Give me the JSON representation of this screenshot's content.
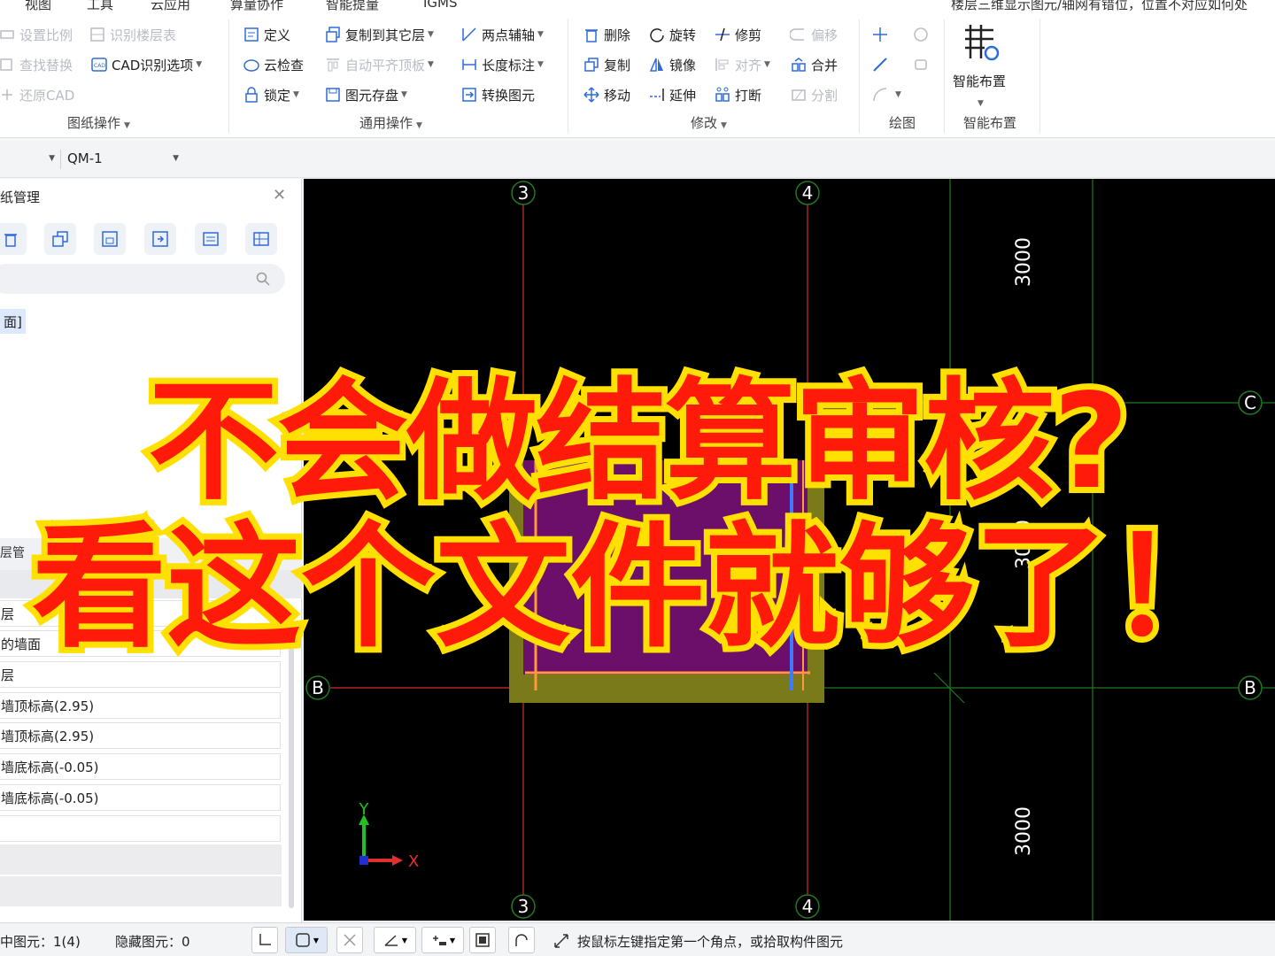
{
  "menu": [
    "视图",
    "工具",
    "云应用",
    "算量协作",
    "智能提量",
    "IGMS"
  ],
  "top_notice": "楼层三维显示图元/轴网有错位，位置不对应如何处",
  "ribbon": {
    "groups": [
      {
        "label": "图纸操作",
        "items": [
          {
            "label": "设置比例",
            "icon": "scale-icon",
            "disabled": true
          },
          {
            "label": "识别楼层表",
            "icon": "floor-table-icon",
            "disabled": true
          },
          {
            "label": "查找替换",
            "icon": "find-replace-icon",
            "disabled": true
          },
          {
            "label": "CAD识别选项",
            "icon": "cad-options-icon",
            "disabled": false
          },
          {
            "label": "还原CAD",
            "icon": "restore-cad-icon",
            "disabled": true
          }
        ]
      },
      {
        "label": "通用操作",
        "items": [
          {
            "label": "定义",
            "icon": "define-icon",
            "disabled": false
          },
          {
            "label": "复制到其它层",
            "icon": "copy-layer-icon",
            "disabled": false
          },
          {
            "label": "两点辅轴",
            "icon": "two-point-axis-icon",
            "disabled": false
          },
          {
            "label": "云检查",
            "icon": "cloud-check-icon",
            "disabled": false
          },
          {
            "label": "自动平齐顶板",
            "icon": "align-top-icon",
            "disabled": true
          },
          {
            "label": "长度标注",
            "icon": "length-dim-icon",
            "disabled": false
          },
          {
            "label": "锁定",
            "icon": "lock-icon",
            "disabled": false
          },
          {
            "label": "图元存盘",
            "icon": "save-element-icon",
            "disabled": false
          },
          {
            "label": "转换图元",
            "icon": "convert-element-icon",
            "disabled": false
          }
        ]
      },
      {
        "label": "修改",
        "items": [
          {
            "label": "删除",
            "icon": "delete-icon",
            "disabled": false
          },
          {
            "label": "旋转",
            "icon": "rotate-icon",
            "disabled": false
          },
          {
            "label": "修剪",
            "icon": "trim-icon",
            "disabled": false
          },
          {
            "label": "偏移",
            "icon": "offset-icon",
            "disabled": true
          },
          {
            "label": "复制",
            "icon": "copy-icon",
            "disabled": false
          },
          {
            "label": "镜像",
            "icon": "mirror-icon",
            "disabled": false
          },
          {
            "label": "对齐",
            "icon": "align-icon",
            "disabled": true
          },
          {
            "label": "合并",
            "icon": "merge-icon",
            "disabled": false
          },
          {
            "label": "移动",
            "icon": "move-icon",
            "disabled": false
          },
          {
            "label": "延伸",
            "icon": "extend-icon",
            "disabled": false
          },
          {
            "label": "打断",
            "icon": "break-icon",
            "disabled": false
          },
          {
            "label": "分割",
            "icon": "split-icon",
            "disabled": true
          }
        ]
      },
      {
        "label": "绘图",
        "items": []
      },
      {
        "label": "智能布置",
        "items": [
          {
            "label": "智能布置",
            "icon": "smart-layout-icon",
            "disabled": false
          }
        ]
      }
    ]
  },
  "selectors": {
    "component_value": "QM-1"
  },
  "left_panel": {
    "title": "纸管理",
    "tag": "面]",
    "sub_title": "层管",
    "properties": [
      "层",
      "的墙面",
      "层",
      "墙顶标高(2.95)",
      "墙顶标高(2.95)",
      "墙底标高(-0.05)",
      "墙底标高(-0.05)"
    ]
  },
  "canvas": {
    "axis_labels_top": [
      "3",
      "4"
    ],
    "axis_labels_bottom": [
      "3",
      "4"
    ],
    "axis_labels_left": [
      "B"
    ],
    "axis_labels_right": [
      "C",
      "B"
    ],
    "dimensions": [
      "3000",
      "3000",
      "3000"
    ],
    "ucs_x": "X",
    "ucs_y": "Y",
    "colors": {
      "background": "#000000",
      "grid_red": "#d0302a",
      "grid_green": "#1f7a1f",
      "wall": "#7a7a1a",
      "fill": "#6b0f6b",
      "highlight": "#ff9a3c",
      "accent": "#3a7bff"
    }
  },
  "status": {
    "selected": "中图元：1(4)",
    "hidden": "隐藏图元：0",
    "hint": "按鼠标左键指定第一个角点，或拾取构件图元"
  },
  "overlay": {
    "line1": "不会做结算审核?",
    "line2": "看这个文件就够了！"
  }
}
